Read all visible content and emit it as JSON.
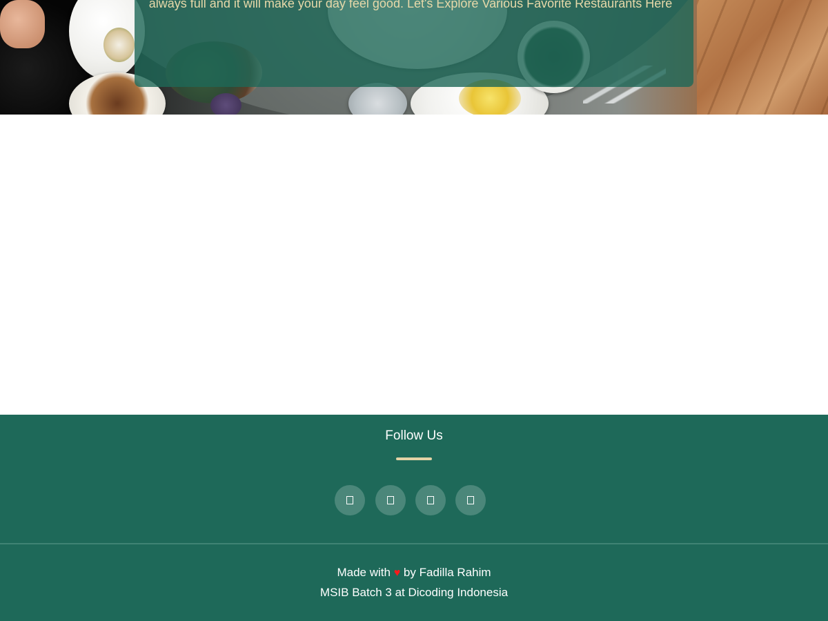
{
  "hero": {
    "text": "always full and it will make your day feel good. Let's Explore Various Favorite Restaurants Here"
  },
  "footer": {
    "follow_title": "Follow Us",
    "social_links": [
      {
        "icon": "facebook-icon",
        "glyph": ""
      },
      {
        "icon": "instagram-icon",
        "glyph": ""
      },
      {
        "icon": "twitter-icon",
        "glyph": ""
      },
      {
        "icon": "github-icon",
        "glyph": ""
      }
    ],
    "credit_prefix": "Made with",
    "heart": "♥",
    "credit_suffix": "by Fadilla Rahim",
    "credit_line2": "MSIB Batch 3 at Dicoding Indonesia"
  },
  "colors": {
    "primary": "#1e6959",
    "accent": "#e4d3a6",
    "hero_text": "#e7d9a9",
    "heart": "#ff1a1a"
  }
}
